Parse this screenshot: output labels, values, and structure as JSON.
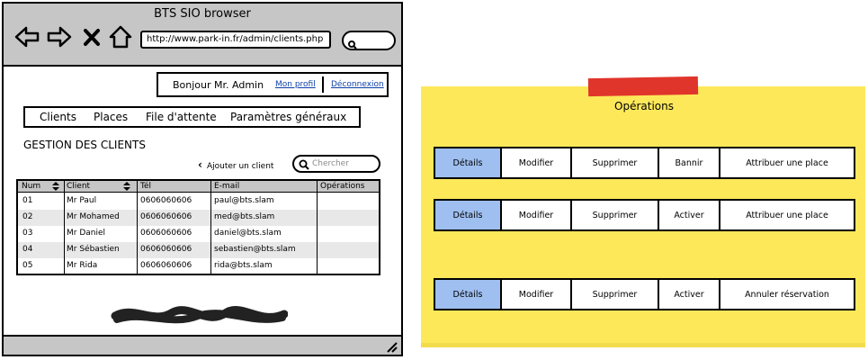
{
  "browser": {
    "title": "BTS SIO browser",
    "url": "http://www.park-in.fr/admin/clients.php"
  },
  "header": {
    "greeting": "Bonjour Mr. Admin",
    "profile_link": "Mon profil",
    "logout_link": "Déconnexion"
  },
  "menu": [
    "Clients",
    "Places",
    "File d'attente",
    "Paramètres généraux"
  ],
  "page": {
    "title": "GESTION DES CLIENTS",
    "add_client": "Ajouter un client",
    "search_placeholder": "Chercher"
  },
  "table": {
    "columns": [
      "Num",
      "Client",
      "Tél",
      "E-mail",
      "Opérations"
    ],
    "rows": [
      [
        "01",
        "Mr Paul",
        "0606060606",
        "paul@bts.slam",
        ""
      ],
      [
        "02",
        "Mr Mohamed",
        "0606060606",
        "med@bts.slam",
        ""
      ],
      [
        "03",
        "Mr Daniel",
        "0606060606",
        "daniel@bts.slam",
        ""
      ],
      [
        "04",
        "Mr Sébastien",
        "0606060606",
        "sebastien@bts.slam",
        ""
      ],
      [
        "05",
        "Mr Rida",
        "0606060606",
        "rida@bts.slam",
        ""
      ]
    ]
  },
  "operations": {
    "title": "Opérations",
    "bars": [
      [
        "Détails",
        "Modifier",
        "Supprimer",
        "Bannir",
        "Attribuer une place"
      ],
      [
        "Détails",
        "Modifier",
        "Supprimer",
        "Activer",
        "Attribuer une place"
      ],
      [
        "Détails",
        "Modifier",
        "Supprimer",
        "Activer",
        "Annuler réservation"
      ]
    ]
  },
  "colors": {
    "chrome": "#c6c6c6",
    "sticky": "#fde85a",
    "tape": "#e0352b",
    "selected": "#9ebff0",
    "link": "#0b3ea8"
  }
}
